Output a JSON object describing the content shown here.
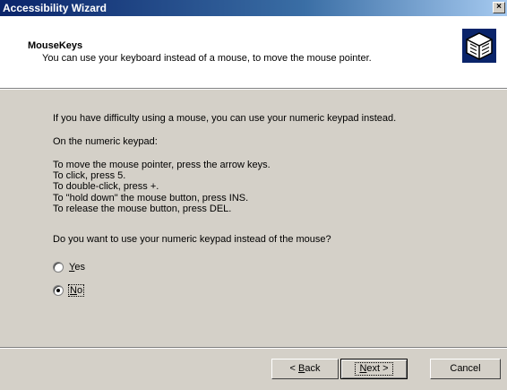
{
  "window": {
    "title": "Accessibility Wizard",
    "close_glyph": "×"
  },
  "header": {
    "title": "MouseKeys",
    "subtitle": "You can use your keyboard instead of a mouse, to move the mouse pointer.",
    "icon": "wizard-book-icon"
  },
  "body": {
    "intro": "If you have difficulty using a mouse, you can use your numeric keypad instead.",
    "keypad_heading": "On the numeric keypad:",
    "instructions": [
      "To move the mouse pointer, press the arrow keys.",
      "To click, press 5.",
      "To double-click, press +.",
      "To \"hold down\" the mouse button, press INS.",
      "To release the mouse button, press DEL."
    ],
    "question": "Do you want to use your numeric keypad instead of the mouse?"
  },
  "options": {
    "yes": {
      "accel": "Y",
      "rest": "es",
      "selected": false
    },
    "no": {
      "accel": "N",
      "rest": "o",
      "selected": true
    }
  },
  "buttons": {
    "back": {
      "prefix": "< ",
      "accel": "B",
      "rest": "ack"
    },
    "next": {
      "accel": "N",
      "rest": "ext >"
    },
    "cancel": "Cancel"
  }
}
